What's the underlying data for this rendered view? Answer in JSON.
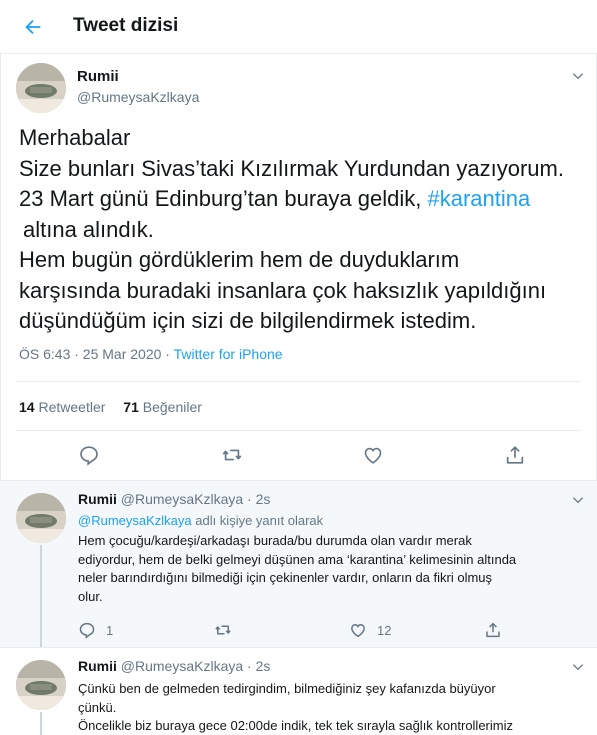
{
  "header": {
    "title": "Tweet dizisi"
  },
  "main_tweet": {
    "name": "Rumii",
    "handle": "@RumeysaKzlkaya",
    "lines": {
      "l1": "Merhabalar",
      "l2": "Size bunları Sivas’taki Kızılırmak Yurdundan yazıyorum.",
      "l3a": "23 Mart günü Edinburg’tan buraya geldik, ",
      "hashtag": "#karantina",
      "l4": "altına alındık.",
      "l5": "Hem bugün gördüklerim hem de duyduklarım",
      "l6": "karşısında buradaki insanlara çok haksızlık yapıldığını",
      "l7": "düşündüğüm için sizi de bilgilendirmek istedim."
    },
    "time": "ÖS 6:43 · 25 Mar 2020",
    "sep": " · ",
    "source": "Twitter for iPhone",
    "retweets_count": "14",
    "retweets_label": "Retweetler",
    "likes_count": "71",
    "likes_label": "Beğeniler"
  },
  "replies": [
    {
      "name": "Rumii",
      "handle": "@RumeysaKzlkaya",
      "time": "2s",
      "reply_to_mention": "@RumeysaKzlkaya",
      "reply_to_suffix": " adlı kişiye yanıt olarak",
      "lines": [
        "Hem çocuğu/kardeşi/arkadaşı burada/bu durumda olan vardır merak",
        "ediyordur, hem de belki gelmeyi düşünen ama ‘karantina’ kelimesinin altında",
        "neler barındırdığını bilmediği için çekinenler vardır, onların da fikri olmuş",
        "olur."
      ],
      "reply_count": "1",
      "like_count": "12"
    },
    {
      "name": "Rumii",
      "handle": "@RumeysaKzlkaya",
      "time": "2s",
      "lines": [
        "Çünkü ben de gelmeden tedirgindim, bilmediğiniz şey kafanızda büyüyor",
        "çünkü.",
        "Öncelikle biz buraya gece 02:00de indik, tek tek sırayla sağlık kontrollerimiz"
      ]
    }
  ],
  "colors": {
    "accent": "#1da1f2",
    "muted": "#657786",
    "text": "#14171a",
    "border": "#e6ecf0"
  },
  "icons": [
    "back-arrow-icon",
    "chevron-down-icon",
    "reply-icon",
    "retweet-icon",
    "like-icon",
    "share-icon"
  ]
}
